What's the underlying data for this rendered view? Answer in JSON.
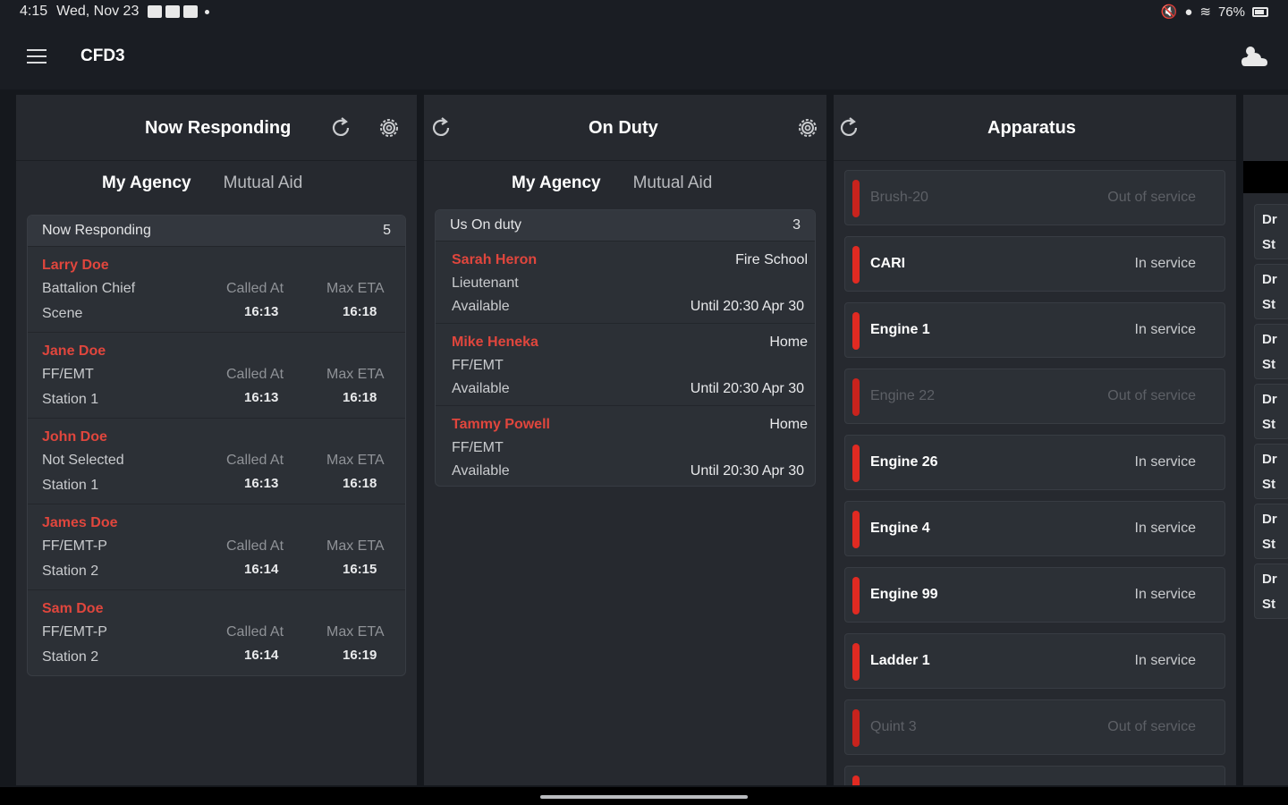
{
  "status_bar": {
    "time": "4:15",
    "date": "Wed, Nov 23",
    "battery": "76%"
  },
  "app": {
    "title": "CFD3"
  },
  "now_responding": {
    "title": "Now Responding",
    "tabs": [
      "My Agency",
      "Mutual Aid"
    ],
    "active_tab": "My Agency",
    "list_title": "Now Responding",
    "count": "5",
    "called_at_label": "Called At",
    "max_eta_label": "Max ETA",
    "responders": [
      {
        "name": "Larry Doe",
        "role": "Battalion Chief",
        "location": "Scene",
        "called_at": "16:13",
        "max_eta": "16:18"
      },
      {
        "name": "Jane Doe",
        "role": "FF/EMT",
        "location": "Station 1",
        "called_at": "16:13",
        "max_eta": "16:18"
      },
      {
        "name": "John Doe",
        "role": "Not Selected",
        "location": "Station 1",
        "called_at": "16:13",
        "max_eta": "16:18"
      },
      {
        "name": "James Doe",
        "role": "FF/EMT-P",
        "location": "Station 2",
        "called_at": "16:14",
        "max_eta": "16:15"
      },
      {
        "name": "Sam Doe",
        "role": "FF/EMT-P",
        "location": "Station 2",
        "called_at": "16:14",
        "max_eta": "16:19"
      }
    ]
  },
  "on_duty": {
    "title": "On Duty",
    "tabs": [
      "My Agency",
      "Mutual Aid"
    ],
    "active_tab": "My Agency",
    "list_title": "Us On duty",
    "count": "3",
    "members": [
      {
        "name": "Sarah Heron",
        "role": "Lieutenant",
        "status": "Available",
        "place": "Fire School",
        "until": "Until 20:30 Apr 30"
      },
      {
        "name": "Mike Heneka",
        "role": "FF/EMT",
        "status": "Available",
        "place": "Home",
        "until": "Until 20:30 Apr 30"
      },
      {
        "name": "Tammy Powell",
        "role": "FF/EMT",
        "status": "Available",
        "place": "Home",
        "until": "Until 20:30 Apr 30"
      }
    ]
  },
  "apparatus": {
    "title": "Apparatus",
    "items": [
      {
        "name": "Brush-20",
        "status": "Out of service"
      },
      {
        "name": "CARI",
        "status": "In service"
      },
      {
        "name": "Engine 1",
        "status": "In service"
      },
      {
        "name": "Engine 22",
        "status": "Out of service"
      },
      {
        "name": "Engine 26",
        "status": "In service"
      },
      {
        "name": "Engine 4",
        "status": "In service"
      },
      {
        "name": "Engine 99",
        "status": "In service"
      },
      {
        "name": "Ladder 1",
        "status": "In service"
      },
      {
        "name": "Quint 3",
        "status": "Out of service"
      }
    ]
  },
  "right_panel": {
    "items": [
      {
        "line1": "Dr",
        "line2": "St"
      },
      {
        "line1": "Dr",
        "line2": "St"
      },
      {
        "line1": "Dr",
        "line2": "St"
      },
      {
        "line1": "Dr",
        "line2": "St"
      },
      {
        "line1": "Dr",
        "line2": "St"
      },
      {
        "line1": "Dr",
        "line2": "St"
      },
      {
        "line1": "Dr",
        "line2": "St"
      }
    ]
  },
  "colors": {
    "accent_red": "#e0463d",
    "bar_red": "#e02a22",
    "panel": "#26292f",
    "background": "#15181d"
  },
  "icons": {
    "menu": "menu-icon",
    "weather": "weather-cloud-icon",
    "refresh": "refresh-icon",
    "settings": "gear-icon"
  }
}
